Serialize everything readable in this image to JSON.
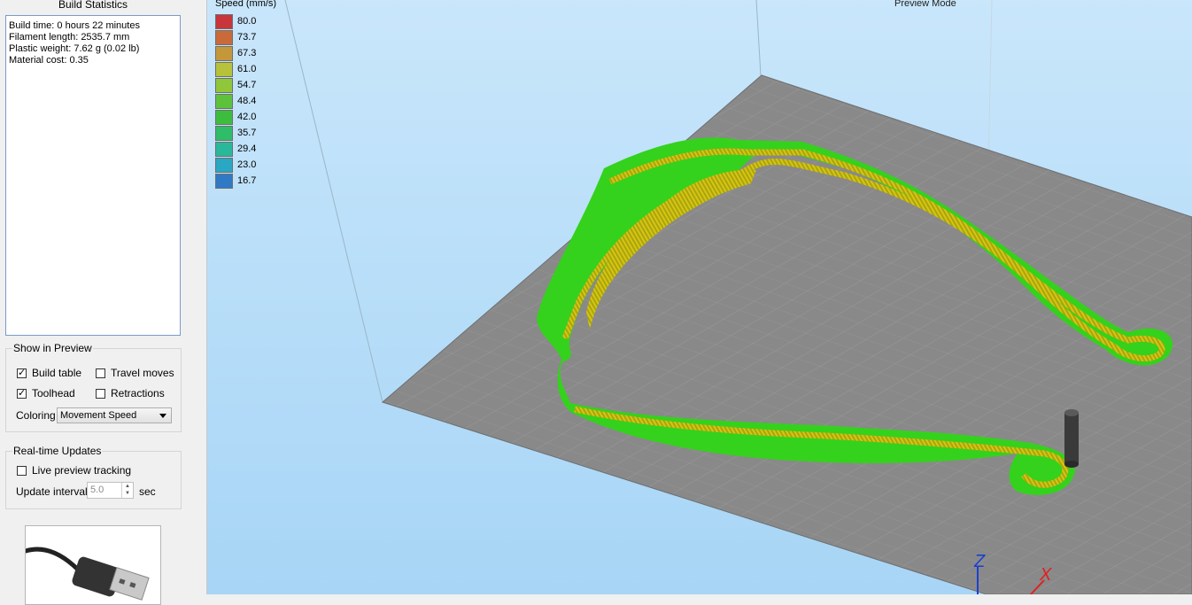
{
  "build_statistics": {
    "title": "Build Statistics",
    "lines": [
      "Build time: 0 hours 22 minutes",
      "Filament length: 2535.7 mm",
      "Plastic weight: 7.62 g (0.02 lb)",
      "Material cost: 0.35"
    ]
  },
  "show_in_preview": {
    "title": "Show in Preview",
    "build_table": {
      "label": "Build table",
      "checked": true
    },
    "travel_moves": {
      "label": "Travel moves",
      "checked": false
    },
    "toolhead": {
      "label": "Toolhead",
      "checked": true
    },
    "retractions": {
      "label": "Retractions",
      "checked": false
    },
    "coloring_label": "Coloring",
    "coloring_value": "Movement Speed"
  },
  "realtime_updates": {
    "title": "Real-time Updates",
    "live_preview": {
      "label": "Live preview tracking",
      "checked": false
    },
    "interval_label": "Update interval",
    "interval_value": "5.0",
    "interval_unit": "sec"
  },
  "viewport": {
    "speed_title": "Speed (mm/s)",
    "mode_label": "Preview Mode",
    "legend": [
      {
        "value": "80.0",
        "color": "#c8353a"
      },
      {
        "value": "73.7",
        "color": "#c96a3a"
      },
      {
        "value": "67.3",
        "color": "#c4973a"
      },
      {
        "value": "61.0",
        "color": "#b5c23a"
      },
      {
        "value": "54.7",
        "color": "#8fc63a"
      },
      {
        "value": "48.4",
        "color": "#5cc23a"
      },
      {
        "value": "42.0",
        "color": "#3dbd3d"
      },
      {
        "value": "35.7",
        "color": "#2fbd68"
      },
      {
        "value": "29.4",
        "color": "#2ab89a"
      },
      {
        "value": "23.0",
        "color": "#2aa7c2"
      },
      {
        "value": "16.7",
        "color": "#3079c4"
      }
    ],
    "axis_labels": {
      "z": "Z",
      "x": "X"
    },
    "icons": [
      "toolhead-icon",
      "usb-cable-icon"
    ]
  },
  "colors": {
    "print_green": "#34d21c",
    "print_yellow": "#d6c413",
    "bed_gray": "#8a8a8a"
  }
}
